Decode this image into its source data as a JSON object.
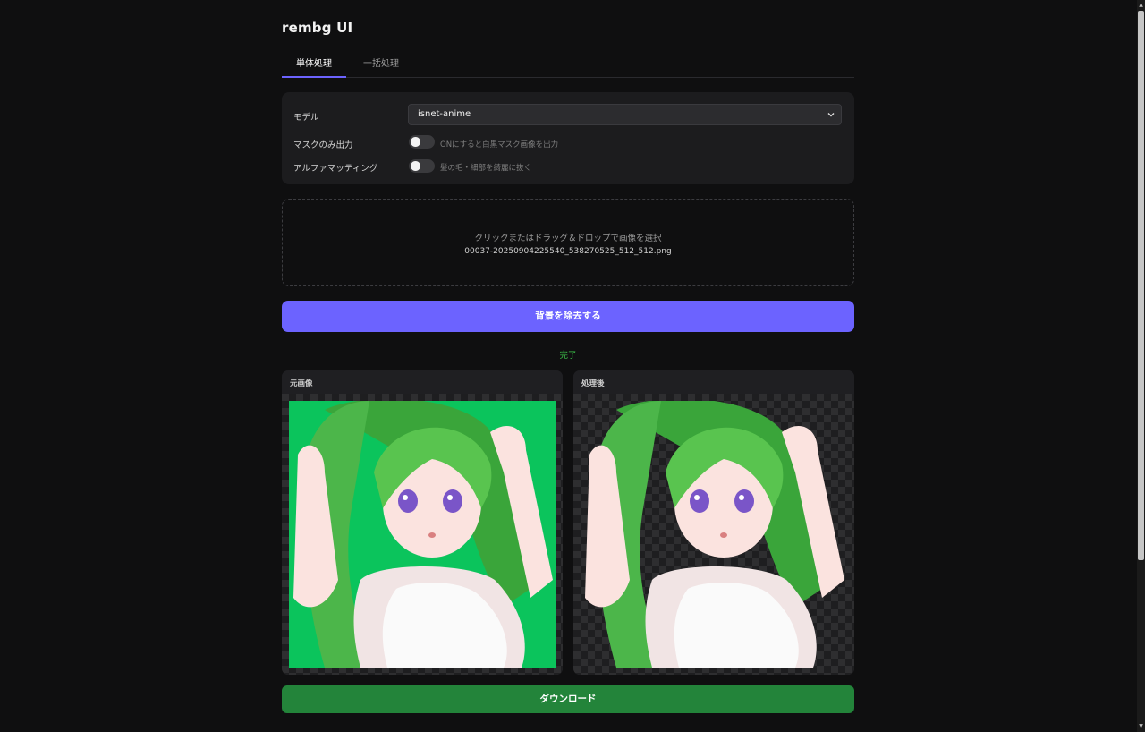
{
  "app": {
    "title": "rembg UI"
  },
  "tabs": [
    {
      "label": "単体処理",
      "active": true
    },
    {
      "label": "一括処理",
      "active": false
    }
  ],
  "settings": {
    "model_label": "モデル",
    "model_value": "isnet-anime",
    "mask_label": "マスクのみ出力",
    "mask_hint": "ONにすると白黒マスク画像を出力",
    "mask_on": false,
    "alpha_label": "アルファマッティング",
    "alpha_hint": "髪の毛・細部を綺麗に抜く",
    "alpha_on": false
  },
  "dropzone": {
    "instruction": "クリックまたはドラッグ＆ドロップで画像を選択",
    "filename": "00037-20250904225540_538270525_512_512.png"
  },
  "actions": {
    "remove_bg_label": "背景を除去する",
    "download_label": "ダウンロード"
  },
  "status": {
    "text": "完了"
  },
  "panels": {
    "original_title": "元画像",
    "result_title": "処理後"
  },
  "colors": {
    "accent": "#6c63ff",
    "success": "#3cc44a",
    "download": "#23843a",
    "green_screen": "#0bc45c"
  }
}
